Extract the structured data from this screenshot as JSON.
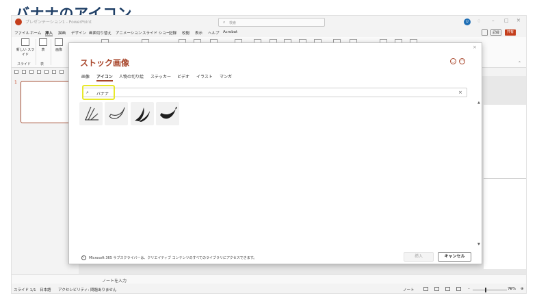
{
  "page_heading": "バナナのアイコン",
  "titlebar": {
    "doc_title": "プレゼンテーション1 - PowerPoint",
    "search_placeholder": "検索",
    "avatar_initials": "U"
  },
  "menubar": {
    "items": [
      "ファイル",
      "ホーム",
      "挿入",
      "描画",
      "デザイン",
      "画面切り替え",
      "アニメーション",
      "スライド ショー",
      "記録",
      "校閲",
      "表示",
      "ヘルプ",
      "Acrobat"
    ],
    "active": "挿入",
    "record_label": "記録",
    "share_label": "共有"
  },
  "ribbon": {
    "new_slide_label": "新しい スライド",
    "table_label": "表",
    "image_label": "画像",
    "group_slides": "スライド",
    "group_table": "表"
  },
  "thumbnails": {
    "slide_number": "1"
  },
  "notes": {
    "placeholder": "ノートを入力"
  },
  "statusbar": {
    "slide_info": "スライド 1/1",
    "language": "日本語",
    "accessibility": "アクセシビリティ: 問題ありません",
    "notes_label": "ノート",
    "zoom": "79%"
  },
  "dialog": {
    "title": "ストック画像",
    "tabs": [
      "画像",
      "アイコン",
      "人物の切り絵",
      "ステッカー",
      "ビデオ",
      "イラスト",
      "マンガ"
    ],
    "selected_tab": "アイコン",
    "search_query": "バナナ",
    "results": [
      "banana-outline-icon",
      "banana-outline-icon",
      "banana-bunch-filled-icon",
      "banana-filled-icon"
    ],
    "footer_info": "Microsoft 365 サブスクライバーは、クリエイティブ コンテンツのすべてのライブラリにアクセスできます。",
    "insert_label": "挿入",
    "cancel_label": "キャンセル",
    "accent_color": "#a8452a",
    "highlight_color": "#e8e82a"
  }
}
